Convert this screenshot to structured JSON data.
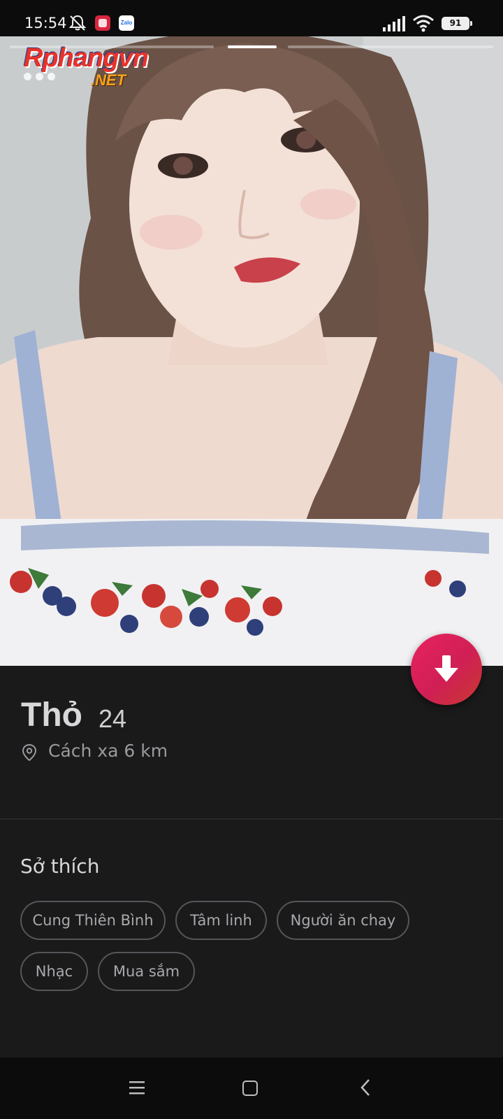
{
  "status_bar": {
    "time": "15:54",
    "battery": "91",
    "app_badge_2": "Zalo"
  },
  "photo": {
    "watermark_main": "Rphangvn",
    "watermark_sub": ".NET",
    "photo_count": 3,
    "active_photo": 2,
    "photo_description": "selfie photo"
  },
  "profile": {
    "name": "Thỏ",
    "age": "24",
    "distance": "Cách xa 6 km"
  },
  "interests": {
    "title": "Sở thích",
    "chips": [
      "Cung Thiên Bình",
      "Tâm linh",
      "Người ăn chay",
      "Nhạc",
      "Mua sắm"
    ]
  },
  "colors": {
    "background": "#1a1a1b",
    "fab_gradient_start": "#e8235f",
    "fab_gradient_end": "#c83a2e"
  },
  "icons": {
    "fab": "arrow-down-icon",
    "location": "location-pin-icon",
    "nav": [
      "menu-icon",
      "home-square-icon",
      "back-chevron-icon"
    ]
  }
}
